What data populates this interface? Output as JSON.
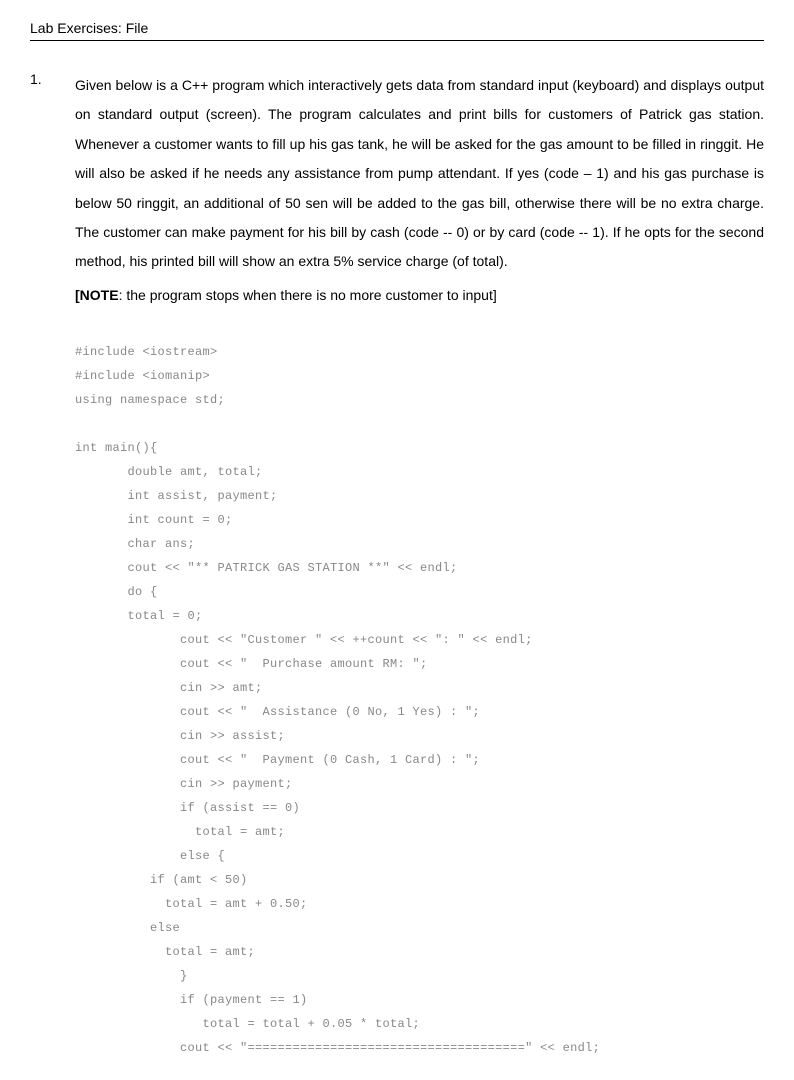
{
  "header": {
    "title": "Lab Exercises: File"
  },
  "question": {
    "number": "1.",
    "paragraph": "Given below is a C++ program which interactively gets data from standard input (keyboard) and displays output on standard output (screen). The program calculates and print bills for customers of Patrick gas station. Whenever a customer wants to fill up his gas tank, he will be asked for the gas amount to be filled in ringgit. He will also be asked if he needs any assistance from pump attendant. If yes (code – 1) and his gas purchase is below 50 ringgit, an additional of 50 sen will be added to the gas bill, otherwise there will be no extra charge.  The customer can make payment for his bill by cash (code -- 0) or by card (code -- 1).  If he opts for the second method, his printed bill will show an extra 5% service charge (of total).",
    "note_label": "[NOTE",
    "note_text": ": the program stops when there is no more customer to input]"
  },
  "code": "#include <iostream>\n#include <iomanip>\nusing namespace std;\n\nint main(){\n       double amt, total;\n       int assist, payment;\n       int count = 0;\n       char ans;\n       cout << \"** PATRICK GAS STATION **\" << endl;\n       do {\n       total = 0;\n              cout << \"Customer \" << ++count << \": \" << endl;\n              cout << \"  Purchase amount RM: \";\n              cin >> amt;\n              cout << \"  Assistance (0 No, 1 Yes) : \";\n              cin >> assist;\n              cout << \"  Payment (0 Cash, 1 Card) : \";\n              cin >> payment;\n              if (assist == 0)\n                total = amt;\n              else {\n          if (amt < 50)\n            total = amt + 0.50;\n          else\n            total = amt;\n              }\n              if (payment == 1)\n                 total = total + 0.05 * total;\n              cout << \"=====================================\" << endl;"
}
